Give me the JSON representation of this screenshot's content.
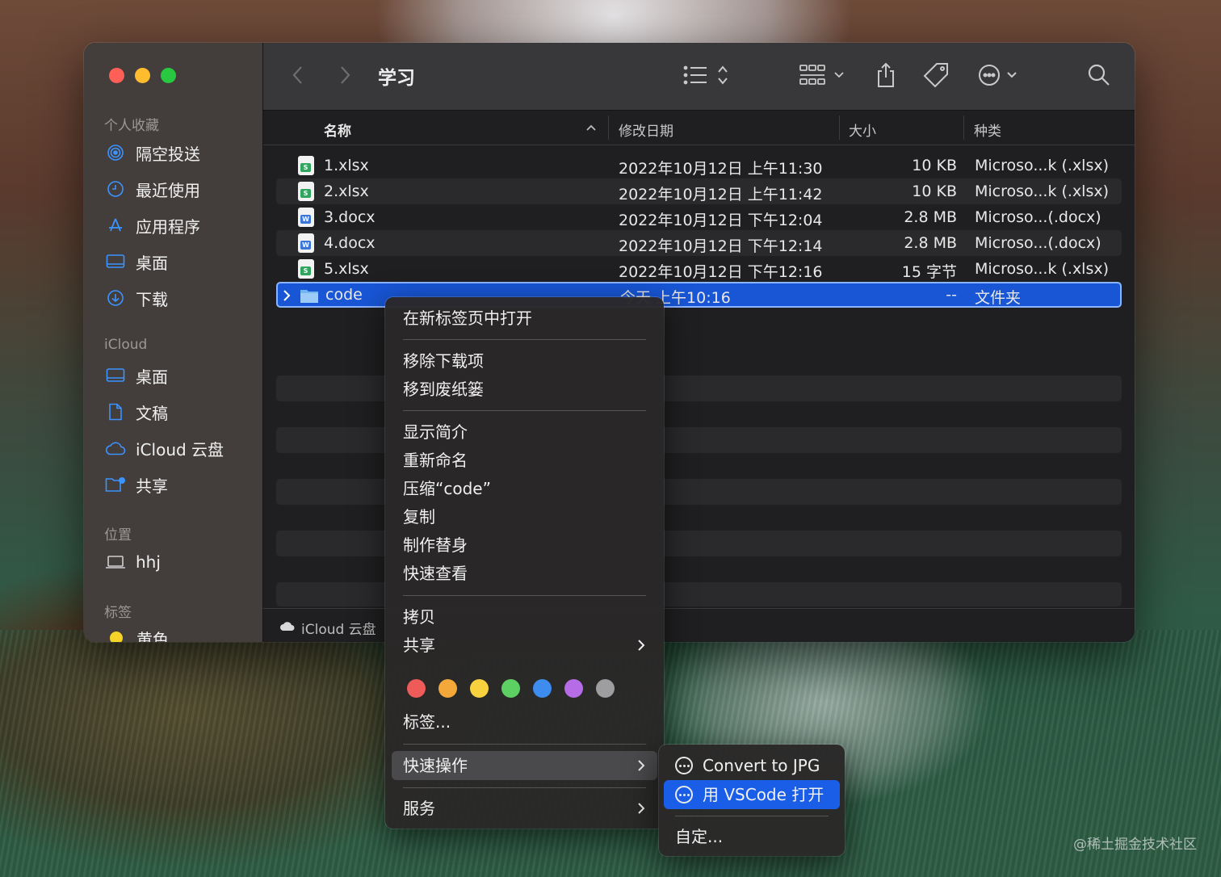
{
  "window": {
    "title": "学习",
    "sidebar": {
      "favorites_header": "个人收藏",
      "favorites": [
        {
          "label": "隔空投送",
          "icon": "airdrop-icon"
        },
        {
          "label": "最近使用",
          "icon": "clock-icon"
        },
        {
          "label": "应用程序",
          "icon": "applications-icon"
        },
        {
          "label": "桌面",
          "icon": "desktop-icon"
        },
        {
          "label": "下载",
          "icon": "download-icon"
        }
      ],
      "icloud_header": "iCloud",
      "icloud": [
        {
          "label": "桌面",
          "icon": "desktop-icon"
        },
        {
          "label": "文稿",
          "icon": "document-icon"
        },
        {
          "label": "iCloud 云盘",
          "icon": "cloud-icon"
        },
        {
          "label": "共享",
          "icon": "shared-folder-icon"
        }
      ],
      "locations_header": "位置",
      "locations": [
        {
          "label": "hhj",
          "icon": "laptop-icon"
        }
      ],
      "tags_header": "标签",
      "tags": [
        {
          "label": "黄色",
          "color": "#f5d327"
        }
      ]
    },
    "columns": {
      "name": "名称",
      "date": "修改日期",
      "size": "大小",
      "kind": "种类"
    },
    "files": [
      {
        "name": "1.xlsx",
        "date": "2022年10月12日 上午11:30",
        "size": "10 KB",
        "kind": "Microso...k (.xlsx)",
        "type": "xlsx"
      },
      {
        "name": "2.xlsx",
        "date": "2022年10月12日 上午11:42",
        "size": "10 KB",
        "kind": "Microso...k (.xlsx)",
        "type": "xlsx"
      },
      {
        "name": "3.docx",
        "date": "2022年10月12日 下午12:04",
        "size": "2.8 MB",
        "kind": "Microso...(.docx)",
        "type": "docx"
      },
      {
        "name": "4.docx",
        "date": "2022年10月12日 下午12:14",
        "size": "2.8 MB",
        "kind": "Microso...(.docx)",
        "type": "docx"
      },
      {
        "name": "5.xlsx",
        "date": "2022年10月12日 下午12:16",
        "size": "15 字节",
        "kind": "Microso...k (.xlsx)",
        "type": "xlsx"
      },
      {
        "name": "code",
        "date": "今天 上午10:16",
        "size": "--",
        "kind": "文件夹",
        "type": "folder"
      }
    ],
    "pathbar": {
      "label": "iCloud 云盘"
    }
  },
  "context_menu": {
    "items": [
      {
        "label": "在新标签页中打开"
      },
      {
        "label": "移除下载项"
      },
      {
        "label": "移到废纸篓"
      },
      {
        "label": "显示简介"
      },
      {
        "label": "重新命名"
      },
      {
        "label": "压缩“code”"
      },
      {
        "label": "复制"
      },
      {
        "label": "制作替身"
      },
      {
        "label": "快速查看"
      },
      {
        "label": "拷贝"
      },
      {
        "label": "共享"
      },
      {
        "label": "标签..."
      },
      {
        "label": "快速操作"
      },
      {
        "label": "服务"
      }
    ],
    "tag_colors": [
      "#ee5b59",
      "#f4a83a",
      "#f7d23e",
      "#5dd063",
      "#3f8cf0",
      "#b56ce6",
      "#9e9ea0"
    ]
  },
  "submenu": {
    "items": [
      {
        "label": "Convert to JPG"
      },
      {
        "label": "用 VSCode 打开"
      },
      {
        "label": "自定..."
      }
    ]
  },
  "watermark": "@稀土掘金技术社区"
}
